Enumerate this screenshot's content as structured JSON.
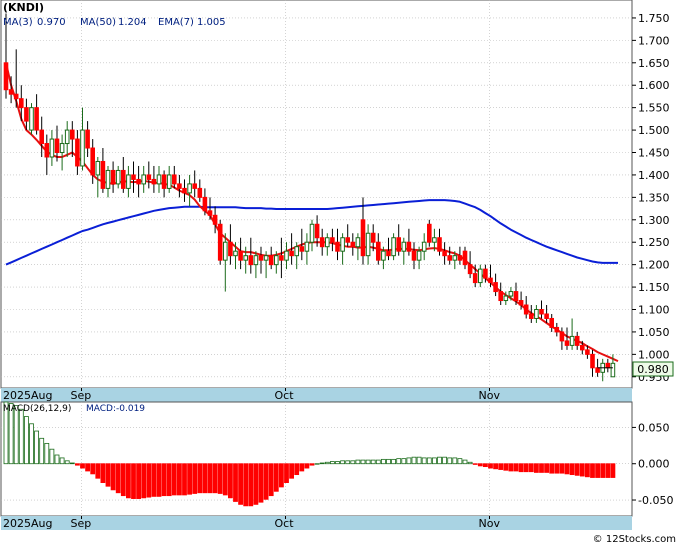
{
  "ticker": "(KNDI)",
  "indicators": {
    "ma3": "MA(3)",
    "ma3_val": "0.970",
    "ma50": "MA(50)",
    "ma50_val": "1.204",
    "ema7": "EMA(7)",
    "ema7_val": "1.005"
  },
  "macd": {
    "label": "MACD(26,12,9)",
    "value_label": "MACD:-0.019"
  },
  "last_price_label": "0.980",
  "watermark": "© 12Stocks.com",
  "colors": {
    "up": "#1a6b1a",
    "down": "#ff0000",
    "ma_blue": "#0a1fd6",
    "ema_red": "#e61010",
    "axis_band": "#a9d3e3",
    "grid": "#b8b8b8",
    "label_navy": "#002080"
  },
  "chart_data": [
    {
      "type": "candlestick",
      "yaxis_ticks": [
        "1.750",
        "1.700",
        "1.650",
        "1.600",
        "1.550",
        "1.500",
        "1.450",
        "1.400",
        "1.350",
        "1.300",
        "1.250",
        "1.200",
        "1.150",
        "1.100",
        "1.050",
        "1.000",
        "0.950"
      ],
      "ylim": [
        0.925,
        1.79
      ],
      "x_labels": [
        {
          "i": 0,
          "label": "2025Aug"
        },
        {
          "i": 15,
          "label": "Sep"
        },
        {
          "i": 55,
          "label": "Oct"
        },
        {
          "i": 95,
          "label": "Nov"
        }
      ],
      "candles": [
        [
          1.65,
          1.76,
          1.57,
          1.59
        ],
        [
          1.59,
          1.62,
          1.56,
          1.58
        ],
        [
          1.58,
          1.68,
          1.55,
          1.57
        ],
        [
          1.57,
          1.6,
          1.52,
          1.55
        ],
        [
          1.55,
          1.57,
          1.5,
          1.52
        ],
        [
          1.5,
          1.56,
          1.49,
          1.55
        ],
        [
          1.55,
          1.58,
          1.49,
          1.5
        ],
        [
          1.5,
          1.53,
          1.44,
          1.47
        ],
        [
          1.47,
          1.49,
          1.4,
          1.44
        ],
        [
          1.44,
          1.5,
          1.42,
          1.48
        ],
        [
          1.48,
          1.51,
          1.43,
          1.45
        ],
        [
          1.45,
          1.49,
          1.41,
          1.47
        ],
        [
          1.47,
          1.52,
          1.44,
          1.5
        ],
        [
          1.5,
          1.52,
          1.44,
          1.48
        ],
        [
          1.48,
          1.5,
          1.4,
          1.42
        ],
        [
          1.42,
          1.55,
          1.41,
          1.5
        ],
        [
          1.5,
          1.52,
          1.44,
          1.46
        ],
        [
          1.46,
          1.48,
          1.38,
          1.4
        ],
        [
          1.4,
          1.44,
          1.35,
          1.43
        ],
        [
          1.43,
          1.46,
          1.36,
          1.37
        ],
        [
          1.37,
          1.42,
          1.35,
          1.41
        ],
        [
          1.41,
          1.43,
          1.36,
          1.38
        ],
        [
          1.38,
          1.42,
          1.37,
          1.41
        ],
        [
          1.41,
          1.44,
          1.36,
          1.37
        ],
        [
          1.37,
          1.42,
          1.35,
          1.4
        ],
        [
          1.4,
          1.43,
          1.36,
          1.39
        ],
        [
          1.39,
          1.42,
          1.35,
          1.38
        ],
        [
          1.38,
          1.42,
          1.36,
          1.4
        ],
        [
          1.4,
          1.43,
          1.37,
          1.39
        ],
        [
          1.39,
          1.42,
          1.36,
          1.38
        ],
        [
          1.38,
          1.42,
          1.36,
          1.4
        ],
        [
          1.4,
          1.41,
          1.35,
          1.37
        ],
        [
          1.37,
          1.42,
          1.36,
          1.4
        ],
        [
          1.4,
          1.42,
          1.37,
          1.38
        ],
        [
          1.38,
          1.4,
          1.35,
          1.37
        ],
        [
          1.37,
          1.39,
          1.34,
          1.36
        ],
        [
          1.36,
          1.4,
          1.33,
          1.38
        ],
        [
          1.38,
          1.41,
          1.35,
          1.37
        ],
        [
          1.37,
          1.39,
          1.34,
          1.35
        ],
        [
          1.35,
          1.37,
          1.31,
          1.32
        ],
        [
          1.32,
          1.35,
          1.3,
          1.31
        ],
        [
          1.31,
          1.33,
          1.27,
          1.29
        ],
        [
          1.29,
          1.3,
          1.2,
          1.21
        ],
        [
          1.21,
          1.27,
          1.14,
          1.25
        ],
        [
          1.25,
          1.29,
          1.2,
          1.22
        ],
        [
          1.22,
          1.25,
          1.19,
          1.23
        ],
        [
          1.23,
          1.26,
          1.19,
          1.21
        ],
        [
          1.21,
          1.24,
          1.18,
          1.22
        ],
        [
          1.22,
          1.26,
          1.18,
          1.2
        ],
        [
          1.2,
          1.23,
          1.17,
          1.22
        ],
        [
          1.22,
          1.24,
          1.18,
          1.21
        ],
        [
          1.21,
          1.23,
          1.17,
          1.22
        ],
        [
          1.22,
          1.24,
          1.19,
          1.2
        ],
        [
          1.2,
          1.23,
          1.18,
          1.22
        ],
        [
          1.22,
          1.26,
          1.17,
          1.21
        ],
        [
          1.21,
          1.25,
          1.19,
          1.23
        ],
        [
          1.23,
          1.27,
          1.2,
          1.22
        ],
        [
          1.22,
          1.25,
          1.19,
          1.24
        ],
        [
          1.24,
          1.28,
          1.21,
          1.23
        ],
        [
          1.23,
          1.27,
          1.2,
          1.25
        ],
        [
          1.25,
          1.3,
          1.23,
          1.29
        ],
        [
          1.29,
          1.31,
          1.24,
          1.26
        ],
        [
          1.26,
          1.28,
          1.22,
          1.24
        ],
        [
          1.24,
          1.27,
          1.22,
          1.26
        ],
        [
          1.26,
          1.28,
          1.23,
          1.25
        ],
        [
          1.25,
          1.28,
          1.21,
          1.23
        ],
        [
          1.23,
          1.27,
          1.2,
          1.26
        ],
        [
          1.26,
          1.29,
          1.24,
          1.25
        ],
        [
          1.25,
          1.27,
          1.22,
          1.24
        ],
        [
          1.24,
          1.27,
          1.21,
          1.26
        ],
        [
          1.3,
          1.35,
          1.2,
          1.22
        ],
        [
          1.22,
          1.29,
          1.2,
          1.27
        ],
        [
          1.27,
          1.29,
          1.23,
          1.25
        ],
        [
          1.25,
          1.27,
          1.2,
          1.21
        ],
        [
          1.21,
          1.24,
          1.19,
          1.23
        ],
        [
          1.23,
          1.26,
          1.21,
          1.22
        ],
        [
          1.22,
          1.27,
          1.21,
          1.26
        ],
        [
          1.26,
          1.29,
          1.22,
          1.23
        ],
        [
          1.23,
          1.26,
          1.2,
          1.25
        ],
        [
          1.25,
          1.28,
          1.22,
          1.23
        ],
        [
          1.23,
          1.25,
          1.19,
          1.21
        ],
        [
          1.21,
          1.24,
          1.19,
          1.23
        ],
        [
          1.23,
          1.27,
          1.21,
          1.25
        ],
        [
          1.29,
          1.3,
          1.24,
          1.25
        ],
        [
          1.25,
          1.28,
          1.23,
          1.26
        ],
        [
          1.26,
          1.28,
          1.22,
          1.23
        ],
        [
          1.23,
          1.25,
          1.2,
          1.22
        ],
        [
          1.22,
          1.24,
          1.2,
          1.21
        ],
        [
          1.21,
          1.23,
          1.19,
          1.22
        ],
        [
          1.22,
          1.24,
          1.2,
          1.21
        ],
        [
          1.23,
          1.24,
          1.19,
          1.2
        ],
        [
          1.2,
          1.23,
          1.17,
          1.18
        ],
        [
          1.18,
          1.2,
          1.15,
          1.16
        ],
        [
          1.16,
          1.2,
          1.15,
          1.19
        ],
        [
          1.19,
          1.2,
          1.16,
          1.17
        ],
        [
          1.17,
          1.2,
          1.15,
          1.16
        ],
        [
          1.16,
          1.18,
          1.13,
          1.14
        ],
        [
          1.14,
          1.16,
          1.11,
          1.12
        ],
        [
          1.12,
          1.14,
          1.11,
          1.13
        ],
        [
          1.13,
          1.15,
          1.12,
          1.14
        ],
        [
          1.14,
          1.16,
          1.11,
          1.12
        ],
        [
          1.12,
          1.14,
          1.1,
          1.11
        ],
        [
          1.11,
          1.13,
          1.08,
          1.09
        ],
        [
          1.09,
          1.11,
          1.07,
          1.08
        ],
        [
          1.08,
          1.11,
          1.07,
          1.1
        ],
        [
          1.1,
          1.12,
          1.08,
          1.09
        ],
        [
          1.09,
          1.11,
          1.07,
          1.08
        ],
        [
          1.08,
          1.09,
          1.05,
          1.06
        ],
        [
          1.06,
          1.07,
          1.04,
          1.05
        ],
        [
          1.05,
          1.06,
          1.01,
          1.03
        ],
        [
          1.03,
          1.06,
          1.01,
          1.02
        ],
        [
          1.02,
          1.08,
          1.01,
          1.04
        ],
        [
          1.04,
          1.05,
          1.01,
          1.02
        ],
        [
          1.02,
          1.03,
          1.0,
          1.01
        ],
        [
          1.01,
          1.02,
          0.99,
          1.0
        ],
        [
          1.0,
          1.01,
          0.95,
          0.97
        ],
        [
          0.97,
          0.99,
          0.95,
          0.96
        ],
        [
          0.96,
          0.99,
          0.94,
          0.98
        ],
        [
          0.98,
          0.99,
          0.96,
          0.97
        ],
        [
          0.95,
          1.0,
          0.95,
          0.98
        ]
      ],
      "ema7": [
        1.65,
        1.6,
        1.565,
        1.525,
        1.5,
        1.49,
        1.478,
        1.465,
        1.452,
        1.445,
        1.44,
        1.44,
        1.445,
        1.45,
        1.44,
        1.43,
        1.415,
        1.4,
        1.39,
        1.385,
        1.382,
        1.38,
        1.383,
        1.386,
        1.385,
        1.384,
        1.385,
        1.387,
        1.385,
        1.383,
        1.382,
        1.38,
        1.378,
        1.372,
        1.365,
        1.36,
        1.355,
        1.345,
        1.33,
        1.32,
        1.31,
        1.29,
        1.27,
        1.26,
        1.25,
        1.24,
        1.23,
        1.228,
        1.228,
        1.225,
        1.222,
        1.22,
        1.22,
        1.222,
        1.225,
        1.23,
        1.235,
        1.24,
        1.245,
        1.248,
        1.25,
        1.25,
        1.25,
        1.25,
        1.248,
        1.245,
        1.242,
        1.24,
        1.24,
        1.238,
        1.238,
        1.24,
        1.238,
        1.235,
        1.232,
        1.232,
        1.234,
        1.235,
        1.235,
        1.235,
        1.233,
        1.232,
        1.234,
        1.236,
        1.237,
        1.235,
        1.232,
        1.228,
        1.225,
        1.22,
        1.21,
        1.2,
        1.19,
        1.18,
        1.17,
        1.16,
        1.15,
        1.14,
        1.132,
        1.125,
        1.118,
        1.11,
        1.1,
        1.092,
        1.085,
        1.078,
        1.07,
        1.062,
        1.055,
        1.048,
        1.04,
        1.035,
        1.03,
        1.025,
        1.018,
        1.012,
        1.005,
        1.0,
        0.995,
        0.99,
        0.985
      ],
      "ma50": [
        1.2,
        1.205,
        1.21,
        1.215,
        1.22,
        1.225,
        1.23,
        1.235,
        1.24,
        1.245,
        1.25,
        1.255,
        1.26,
        1.265,
        1.27,
        1.275,
        1.278,
        1.282,
        1.286,
        1.29,
        1.293,
        1.296,
        1.299,
        1.302,
        1.305,
        1.308,
        1.311,
        1.314,
        1.317,
        1.32,
        1.322,
        1.324,
        1.326,
        1.327,
        1.328,
        1.329,
        1.329,
        1.329,
        1.329,
        1.328,
        1.328,
        1.328,
        1.328,
        1.328,
        1.328,
        1.328,
        1.327,
        1.326,
        1.326,
        1.326,
        1.326,
        1.325,
        1.325,
        1.324,
        1.324,
        1.324,
        1.324,
        1.324,
        1.324,
        1.324,
        1.324,
        1.324,
        1.324,
        1.324,
        1.325,
        1.326,
        1.327,
        1.328,
        1.329,
        1.33,
        1.331,
        1.332,
        1.333,
        1.334,
        1.335,
        1.336,
        1.337,
        1.338,
        1.339,
        1.34,
        1.341,
        1.342,
        1.343,
        1.344,
        1.344,
        1.344,
        1.344,
        1.343,
        1.342,
        1.34,
        1.336,
        1.332,
        1.328,
        1.322,
        1.315,
        1.308,
        1.3,
        1.292,
        1.285,
        1.278,
        1.272,
        1.266,
        1.26,
        1.255,
        1.25,
        1.245,
        1.24,
        1.236,
        1.232,
        1.228,
        1.224,
        1.22,
        1.216,
        1.213,
        1.21,
        1.207,
        1.205,
        1.204,
        1.204,
        1.204,
        1.204
      ],
      "ma3_line": [
        null,
        null,
        null,
        null,
        null,
        null,
        null,
        null,
        null,
        null,
        null,
        null,
        null,
        null,
        null,
        null,
        null,
        null,
        null,
        null,
        null,
        null,
        null,
        null,
        null,
        null,
        null,
        null,
        null,
        null,
        null,
        null,
        null,
        null,
        null,
        null,
        null,
        null,
        null,
        null,
        null,
        null,
        null,
        null,
        null,
        null,
        null,
        null,
        null,
        null,
        null,
        null,
        null,
        null,
        null,
        null,
        null,
        null,
        null,
        null,
        null,
        null,
        null,
        null,
        null,
        null,
        null,
        null,
        null,
        null,
        null,
        null,
        null,
        null,
        null,
        null,
        null,
        null,
        null,
        null,
        null,
        null,
        null,
        null,
        null,
        null,
        null,
        null,
        null,
        null,
        null,
        null,
        null,
        null,
        null,
        null,
        null,
        null,
        null,
        null,
        null,
        null,
        null,
        null,
        null,
        null,
        null,
        null,
        null,
        null,
        null,
        null,
        null,
        null,
        null,
        null,
        0.97,
        0.97,
        0.97,
        0.97
      ]
    },
    {
      "type": "bar",
      "title": "MACD(26,12,9)",
      "yaxis_ticks": [
        "0.050",
        "0.000",
        "-0.050"
      ],
      "ylim": [
        -0.072,
        0.085
      ],
      "x_labels": [
        {
          "i": 0,
          "label": "2025Aug"
        },
        {
          "i": 15,
          "label": "Sep"
        },
        {
          "i": 55,
          "label": "Oct"
        },
        {
          "i": 95,
          "label": "Nov"
        }
      ],
      "values": [
        0.085,
        0.083,
        0.08,
        0.075,
        0.065,
        0.055,
        0.045,
        0.035,
        0.028,
        0.02,
        0.012,
        0.008,
        0.004,
        0.001,
        -0.002,
        -0.006,
        -0.01,
        -0.014,
        -0.02,
        -0.026,
        -0.031,
        -0.036,
        -0.04,
        -0.044,
        -0.047,
        -0.048,
        -0.048,
        -0.047,
        -0.046,
        -0.045,
        -0.045,
        -0.044,
        -0.044,
        -0.043,
        -0.043,
        -0.043,
        -0.042,
        -0.041,
        -0.04,
        -0.04,
        -0.04,
        -0.04,
        -0.041,
        -0.043,
        -0.047,
        -0.052,
        -0.056,
        -0.058,
        -0.058,
        -0.056,
        -0.053,
        -0.049,
        -0.044,
        -0.038,
        -0.032,
        -0.026,
        -0.02,
        -0.015,
        -0.01,
        -0.006,
        -0.002,
        0.0,
        0.001,
        0.002,
        0.003,
        0.003,
        0.004,
        0.004,
        0.004,
        0.005,
        0.005,
        0.005,
        0.005,
        0.005,
        0.006,
        0.006,
        0.006,
        0.007,
        0.007,
        0.008,
        0.009,
        0.009,
        0.008,
        0.008,
        0.008,
        0.009,
        0.009,
        0.008,
        0.008,
        0.007,
        0.005,
        0.002,
        -0.001,
        -0.003,
        -0.004,
        -0.006,
        -0.007,
        -0.008,
        -0.009,
        -0.01,
        -0.01,
        -0.011,
        -0.011,
        -0.011,
        -0.012,
        -0.012,
        -0.012,
        -0.013,
        -0.013,
        -0.013,
        -0.014,
        -0.015,
        -0.016,
        -0.017,
        -0.018,
        -0.019,
        -0.019,
        -0.019,
        -0.019,
        -0.019
      ]
    }
  ]
}
